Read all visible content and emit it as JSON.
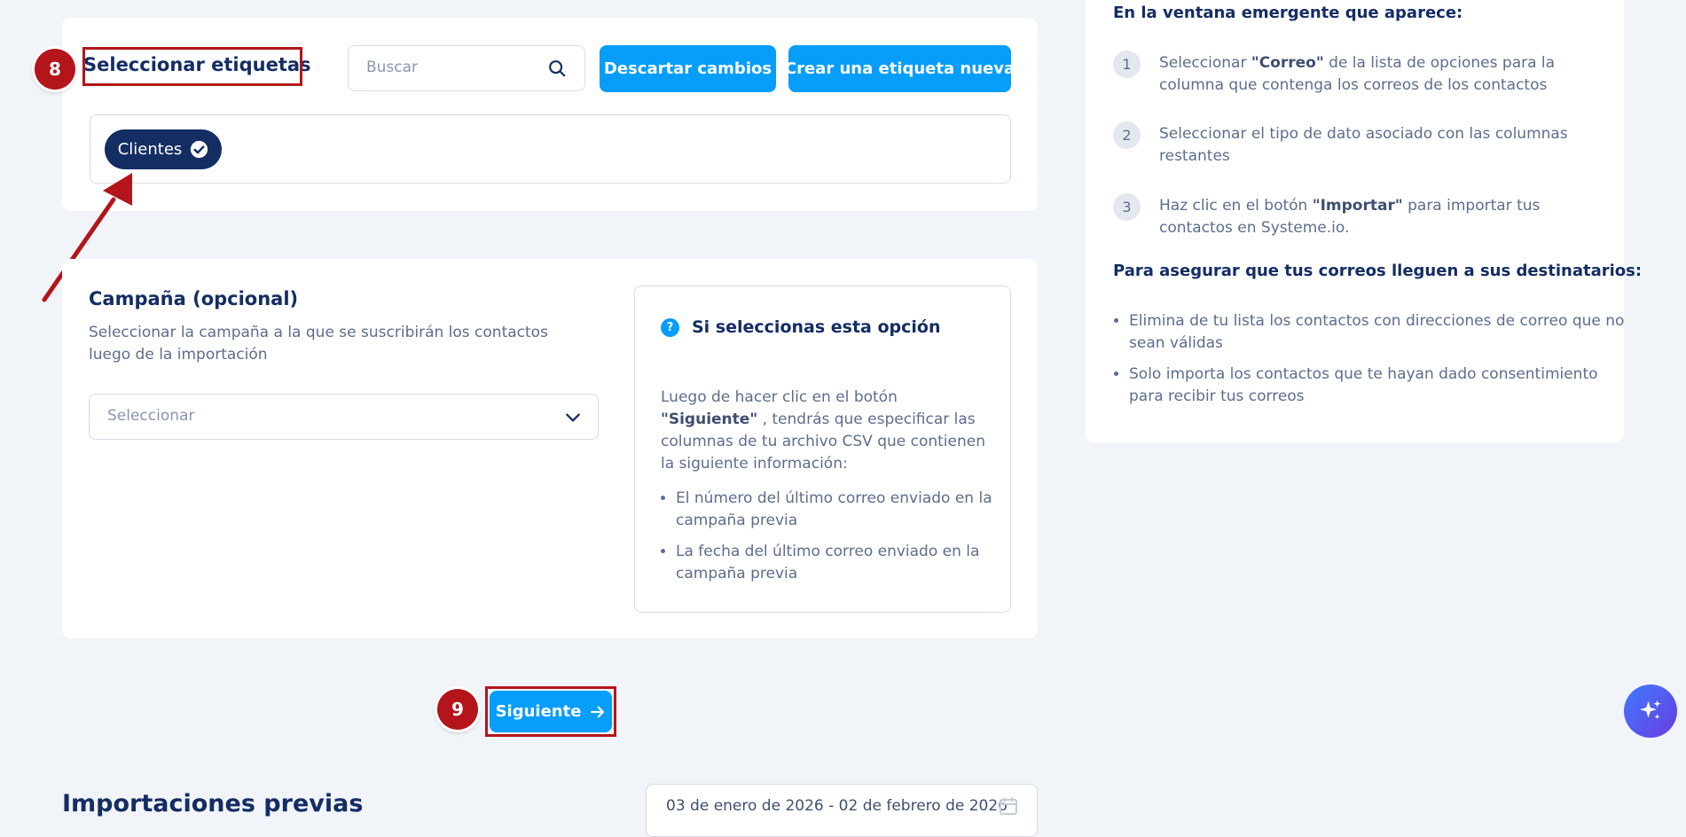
{
  "tags_section": {
    "title": "Seleccionar etiquetas",
    "search_placeholder": "Buscar",
    "discard_label": "Descartar cambios",
    "create_label": "Crear una etiqueta nueva",
    "selected_tags": [
      "Clientes"
    ]
  },
  "steps": {
    "tags_step": "8",
    "next_step": "9"
  },
  "campaign": {
    "title": "Campaña (opcional)",
    "description": "Seleccionar la campaña a la que se suscribirán los contactos luego de la importación",
    "select_placeholder": "Seleccionar",
    "info": {
      "icon_glyph": "?",
      "title": "Si seleccionas esta opción",
      "text_before": "Luego de hacer clic en el botón ",
      "text_bold": "\"Siguiente\"",
      "text_after": " , tendrás que especificar las columnas de tu archivo CSV que contienen la siguiente información:",
      "items": [
        "El número del último correo enviado en la campaña previa",
        "La fecha del último correo enviado en la campaña previa"
      ]
    }
  },
  "next_button": {
    "label": "Siguiente"
  },
  "previous_imports": {
    "title": "Importaciones previas",
    "date_range": "03 de enero de 2026 - 02 de febrero de 2026"
  },
  "right_panel": {
    "title": "En la ventana emergente que aparece:",
    "steps": [
      {
        "num": "1",
        "before": "Seleccionar ",
        "bold": "\"Correo\"",
        "after": " de la lista de opciones para la columna que contenga los correos de los contactos"
      },
      {
        "num": "2",
        "before": "Seleccionar el tipo de dato asociado con las columnas restantes",
        "bold": "",
        "after": ""
      },
      {
        "num": "3",
        "before": "Haz clic en el botón ",
        "bold": "\"Importar\"",
        "after": " para importar tus contactos en Systeme.io."
      }
    ],
    "subtitle": "Para asegurar que tus correos lleguen a sus destinatarios:",
    "items": [
      "Elimina de tu lista los contactos con direcciones de correo que no sean válidas",
      "Solo importa los contactos que te hayan dado consentimiento para recibir tus correos"
    ]
  },
  "colors": {
    "accent": "#079dfb",
    "navy": "#142d63",
    "annotation_red": "#b3151b",
    "background": "#f1f4f9"
  },
  "icons": [
    "search-icon",
    "check-circle-icon",
    "chevron-down-icon",
    "info-icon",
    "arrow-right-icon",
    "calendar-icon",
    "sparkles-icon"
  ]
}
